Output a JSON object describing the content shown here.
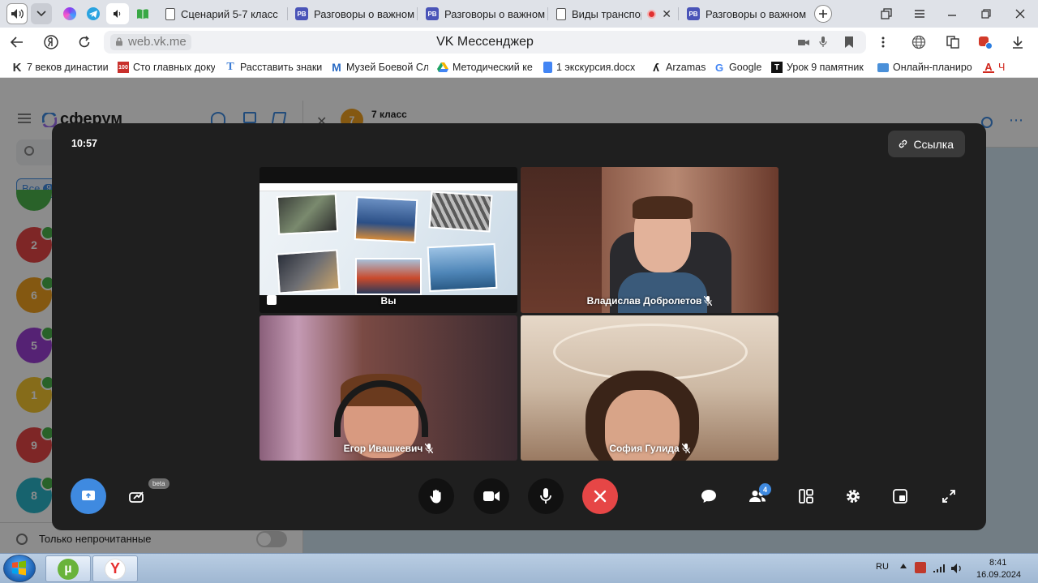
{
  "browser": {
    "tabs": [
      {
        "label": "Сценарий 5-7 класс",
        "icon": "doc"
      },
      {
        "label": "Разговоры о важном",
        "icon": "РВ"
      },
      {
        "label": "Разговоры о важном",
        "icon": "РВ"
      },
      {
        "label": "Виды транспорт",
        "icon": "doc"
      },
      {
        "label": "Разговоры о важном",
        "icon": "РВ"
      }
    ],
    "address": {
      "host": "web.vk.me",
      "page_title": "VK Мессенджер"
    },
    "bookmarks": [
      {
        "label": "7 веков династии",
        "icon": "K"
      },
      {
        "label": "Сто главных доку",
        "icon": "100"
      },
      {
        "label": "Расставить знаки",
        "icon": "T"
      },
      {
        "label": "Музей Боевой Сл",
        "icon": "M"
      },
      {
        "label": "Методический ке",
        "icon": "drive"
      },
      {
        "label": "1 экскурсия.docx",
        "icon": "docs"
      },
      {
        "label": "Arzamas",
        "icon": "A"
      },
      {
        "label": "Google",
        "icon": "G"
      },
      {
        "label": "Урок 9 памятник",
        "icon": "T"
      },
      {
        "label": "Онлайн-планиро",
        "icon": "cal"
      },
      {
        "label": "Ч",
        "icon": "A"
      }
    ]
  },
  "messenger": {
    "logo": "сферум",
    "filter_all": "Все",
    "filter_all_count": "9",
    "unread_only": "Только непрочитанные",
    "chat_header_title": "7 класс",
    "chat_header_avatar": "7",
    "avatars": [
      {
        "label": "2",
        "color": "#e64646"
      },
      {
        "label": "6",
        "color": "#f0a020"
      },
      {
        "label": "5",
        "color": "#9b3fd4"
      },
      {
        "label": "1",
        "color": "#f5c530"
      },
      {
        "label": "9",
        "color": "#e64646"
      },
      {
        "label": "8",
        "color": "#2ab5c8"
      }
    ]
  },
  "call": {
    "time": "10:57",
    "link_label": "Ссылка",
    "participants": [
      {
        "name": "Вы"
      },
      {
        "name": "Владислав Добролетов"
      },
      {
        "name": "Егор Ивашкевич"
      },
      {
        "name": "София Гулида"
      }
    ],
    "beta_badge": "beta",
    "participants_count": "4"
  },
  "taskbar": {
    "lang": "RU",
    "time": "8:41",
    "date": "16.09.2024"
  }
}
